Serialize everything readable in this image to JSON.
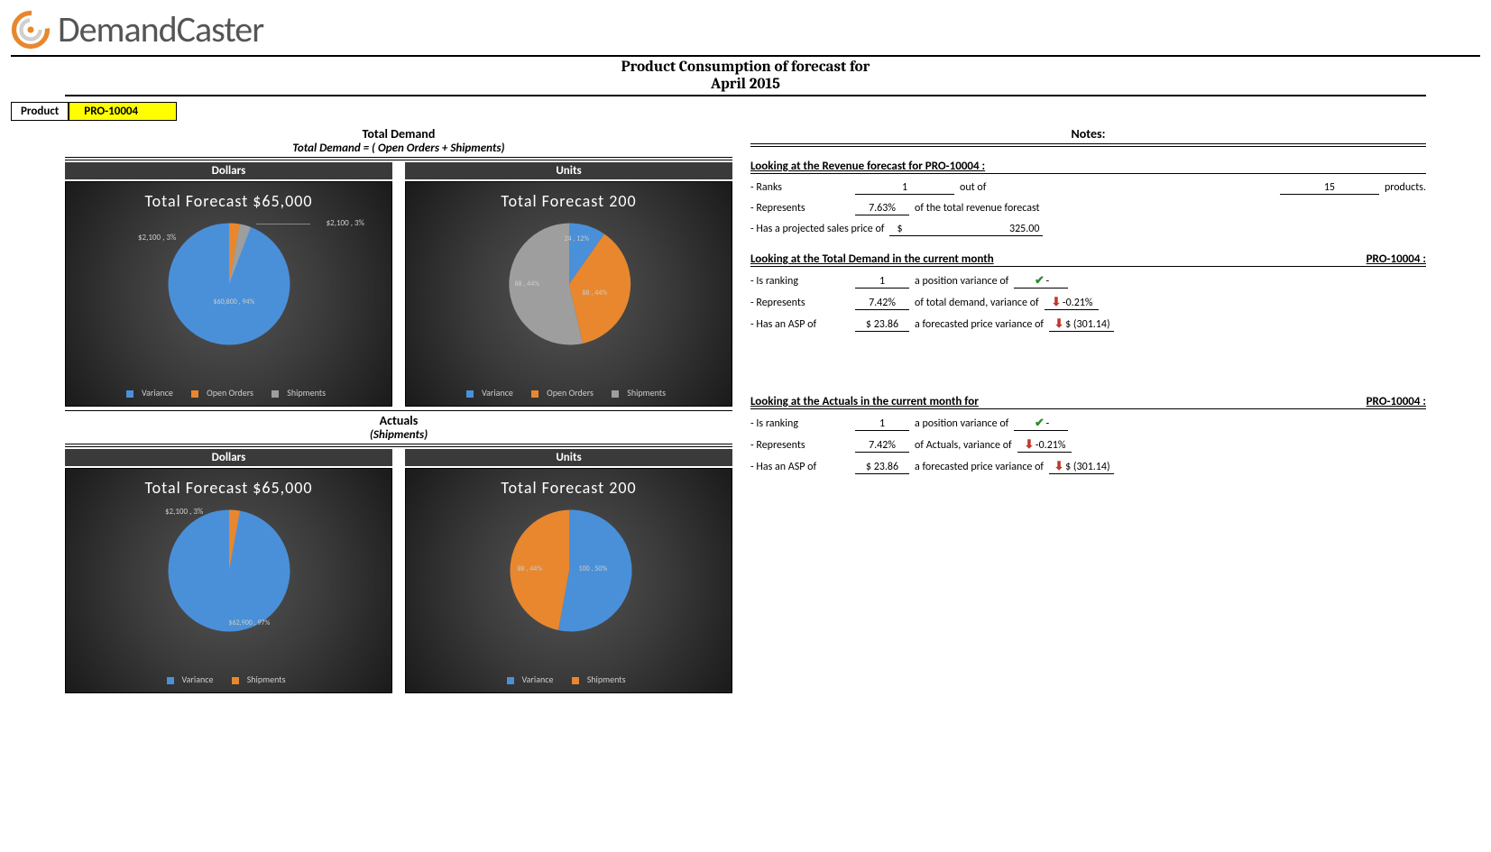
{
  "brand": "DemandCaster",
  "report": {
    "title_line1": "Product Consumption of forecast for",
    "title_line2": "April  2015",
    "product_label": "Product",
    "product_value": "PRO-10004"
  },
  "sections": {
    "total_demand_title": "Total Demand",
    "total_demand_sub": "Total Demand = ( Open Orders + Shipments)",
    "actuals_title": "Actuals",
    "actuals_sub": "(Shipments)",
    "dollars": "Dollars",
    "units": "Units",
    "notes": "Notes:"
  },
  "legend": {
    "variance": "Variance",
    "open_orders": "Open Orders",
    "shipments": "Shipments"
  },
  "charts": {
    "td_dollars": {
      "title": "Total  Forecast   $65,000",
      "callout1": "$2,100 , 3%",
      "callout2": "$2,100 , 3%",
      "center": "$60,800 , 94%"
    },
    "td_units": {
      "title": "Total  Forecast    200",
      "l1": "24 , 12%",
      "l2": "88 , 44%",
      "l3": "88 , 44%"
    },
    "ac_dollars": {
      "title": "Total  Forecast   $65,000",
      "callout1": "$2,100 , 3%",
      "center": "$62,900 , 97%"
    },
    "ac_units": {
      "title": "Total  Forecast     200",
      "l1": "88 , 44%",
      "l2": "100 , 50%"
    }
  },
  "notes1": {
    "heading": "Looking at the Revenue forecast for PRO-10004 :",
    "rank_lbl": "- Ranks",
    "rank": "1",
    "out_of": "out of",
    "rank_total": "15",
    "prod": "products.",
    "rep_lbl": "- Represents",
    "rep": "7.63%",
    "rep_tail": "of the total revenue forecast",
    "asp_lbl": "- Has a projected sales price of",
    "asp_pre": "$",
    "asp": "325.00"
  },
  "notes2": {
    "heading": "Looking at the Total Demand in the current month",
    "heading_prod": "PRO-10004 :",
    "rank_lbl": "- Is ranking",
    "rank": "1",
    "pv": "a position variance of",
    "pv_val": "-",
    "rep_lbl": "- Represents",
    "rep": "7.42%",
    "rep_tail": "of total demand, variance of",
    "rep_var": "-0.21%",
    "asp_lbl": "- Has an ASP of",
    "asp": "$  23.86",
    "asp_tail": "a forecasted price variance of",
    "asp_var": "$  (301.14)"
  },
  "notes3": {
    "heading": "Looking at the Actuals in the current month for",
    "heading_prod": "PRO-10004 :",
    "rank_lbl": "- Is ranking",
    "rank": "1",
    "pv": "a position variance of",
    "pv_val": "-",
    "rep_lbl": "- Represents",
    "rep": "7.42%",
    "rep_tail": "of Actuals, variance of",
    "rep_var": "-0.21%",
    "asp_lbl": "- Has an ASP of",
    "asp": "$  23.86",
    "asp_tail": "a forecasted price variance of",
    "asp_var": "$  (301.14)"
  },
  "chart_data": [
    {
      "type": "pie",
      "title": "Total Demand — Dollars, Total Forecast $65,000",
      "series": [
        {
          "name": "Variance",
          "value": 60800,
          "pct": 94
        },
        {
          "name": "Open Orders",
          "value": 2100,
          "pct": 3
        },
        {
          "name": "Shipments",
          "value": 2100,
          "pct": 3
        }
      ],
      "unit": "USD"
    },
    {
      "type": "pie",
      "title": "Total Demand — Units, Total Forecast 200",
      "series": [
        {
          "name": "Variance",
          "value": 24,
          "pct": 12
        },
        {
          "name": "Open Orders",
          "value": 88,
          "pct": 44
        },
        {
          "name": "Shipments",
          "value": 88,
          "pct": 44
        }
      ],
      "unit": "units"
    },
    {
      "type": "pie",
      "title": "Actuals — Dollars, Total Forecast $65,000",
      "series": [
        {
          "name": "Variance",
          "value": 62900,
          "pct": 97
        },
        {
          "name": "Shipments",
          "value": 2100,
          "pct": 3
        }
      ],
      "unit": "USD"
    },
    {
      "type": "pie",
      "title": "Actuals — Units, Total Forecast 200",
      "series": [
        {
          "name": "Variance",
          "value": 100,
          "pct": 50
        },
        {
          "name": "Shipments",
          "value": 88,
          "pct": 44
        }
      ],
      "unit": "units"
    }
  ]
}
